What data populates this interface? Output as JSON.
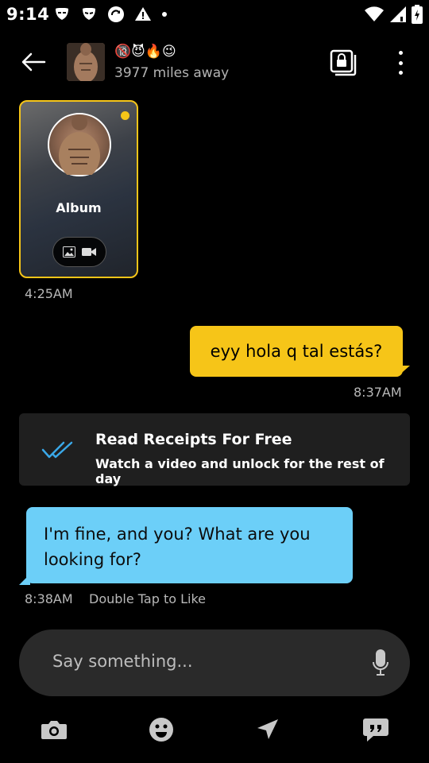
{
  "status_bar": {
    "time": "9:14",
    "left_icons": [
      "app-icon-1",
      "app-icon-2",
      "sync-icon",
      "warning-icon",
      "dot-icon"
    ],
    "right_icons": [
      "wifi-icon",
      "signal-icon",
      "battery-icon"
    ]
  },
  "header": {
    "emojis": "🔞😈🔥😉",
    "distance": "3977 miles away"
  },
  "album": {
    "label": "Album",
    "timestamp": "4:25AM"
  },
  "outgoing": {
    "text": "eyy hola q tal estás?",
    "timestamp": "8:37AM"
  },
  "read_receipts": {
    "title": "Read Receipts For Free",
    "subtitle": "Watch a video and unlock for the rest of day"
  },
  "incoming": {
    "text": "I'm fine, and you? What are you looking for?",
    "timestamp": "8:38AM",
    "hint": "Double Tap to Like"
  },
  "composer": {
    "placeholder": "Say something..."
  },
  "bottom_bar": {
    "icons": [
      "camera-icon",
      "emoji-icon",
      "location-icon",
      "phrases-icon"
    ]
  },
  "colors": {
    "accent_yellow": "#f6c518",
    "incoming_blue": "#6ccff8",
    "receipt_blue": "#3aa8e8",
    "background": "#000000",
    "card": "#1f1f1f"
  }
}
